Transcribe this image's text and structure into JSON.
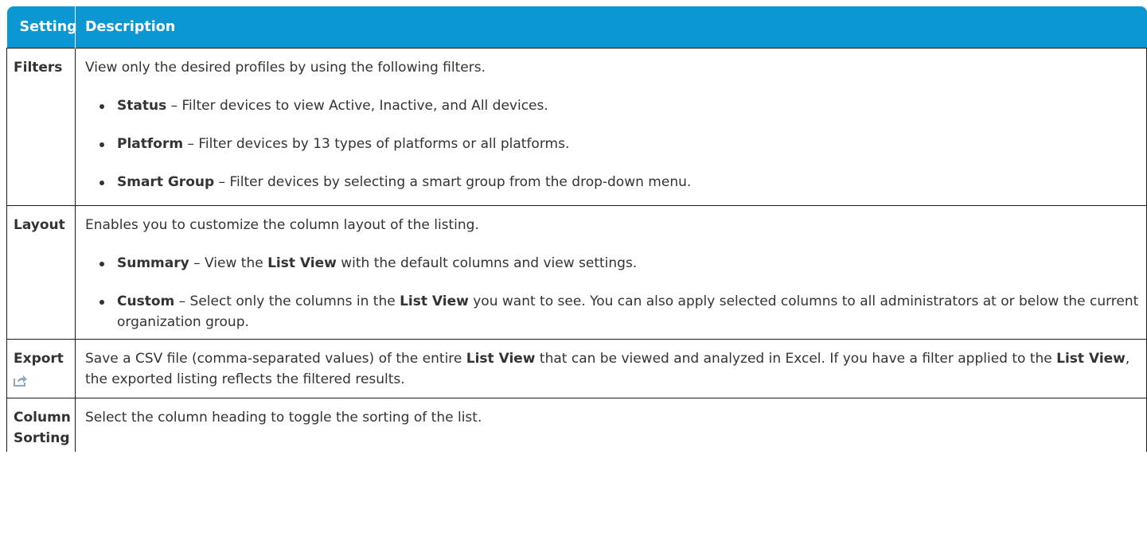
{
  "header": {
    "setting": "Setting",
    "description": "Description"
  },
  "rows": {
    "filters": {
      "name": "Filters",
      "lead": "View only the desired profiles by using the following filters.",
      "bullets": [
        {
          "term": "Status",
          "text": " – Filter devices to view Active, Inactive, and All devices."
        },
        {
          "term": "Platform",
          "text": " – Filter devices by 13 types of platforms or all platforms."
        },
        {
          "term": "Smart Group",
          "text": " – Filter devices by selecting a smart group from the drop-down menu."
        }
      ]
    },
    "layout": {
      "name": "Layout",
      "lead": "Enables you to customize the column layout of the listing.",
      "summary": {
        "term": "Summary",
        "t1": " – View the ",
        "b1": "List View",
        "t2": " with the default columns and view settings."
      },
      "custom": {
        "term": "Custom",
        "t1": " – Select only the columns in the ",
        "b1": "List View",
        "t2": " you want to see. You can also apply selected columns to all administrators at or below the current organization group."
      }
    },
    "export": {
      "name": "Export",
      "icon": "export-icon",
      "t1": "Save a CSV file (comma-separated values) of the entire ",
      "b1": "List View",
      "t2": " that can be viewed and analyzed in Excel. If you have a filter applied to the ",
      "b2": "List View",
      "t3": ", the exported listing reflects the filtered results."
    },
    "column_sorting": {
      "name": "Column Sorting",
      "text": "Select the column heading to toggle the sorting of the list."
    }
  },
  "colors": {
    "header_bg": "#0a97d4",
    "header_text": "#ffffff",
    "border": "#1b1b1b",
    "text": "#333333"
  }
}
